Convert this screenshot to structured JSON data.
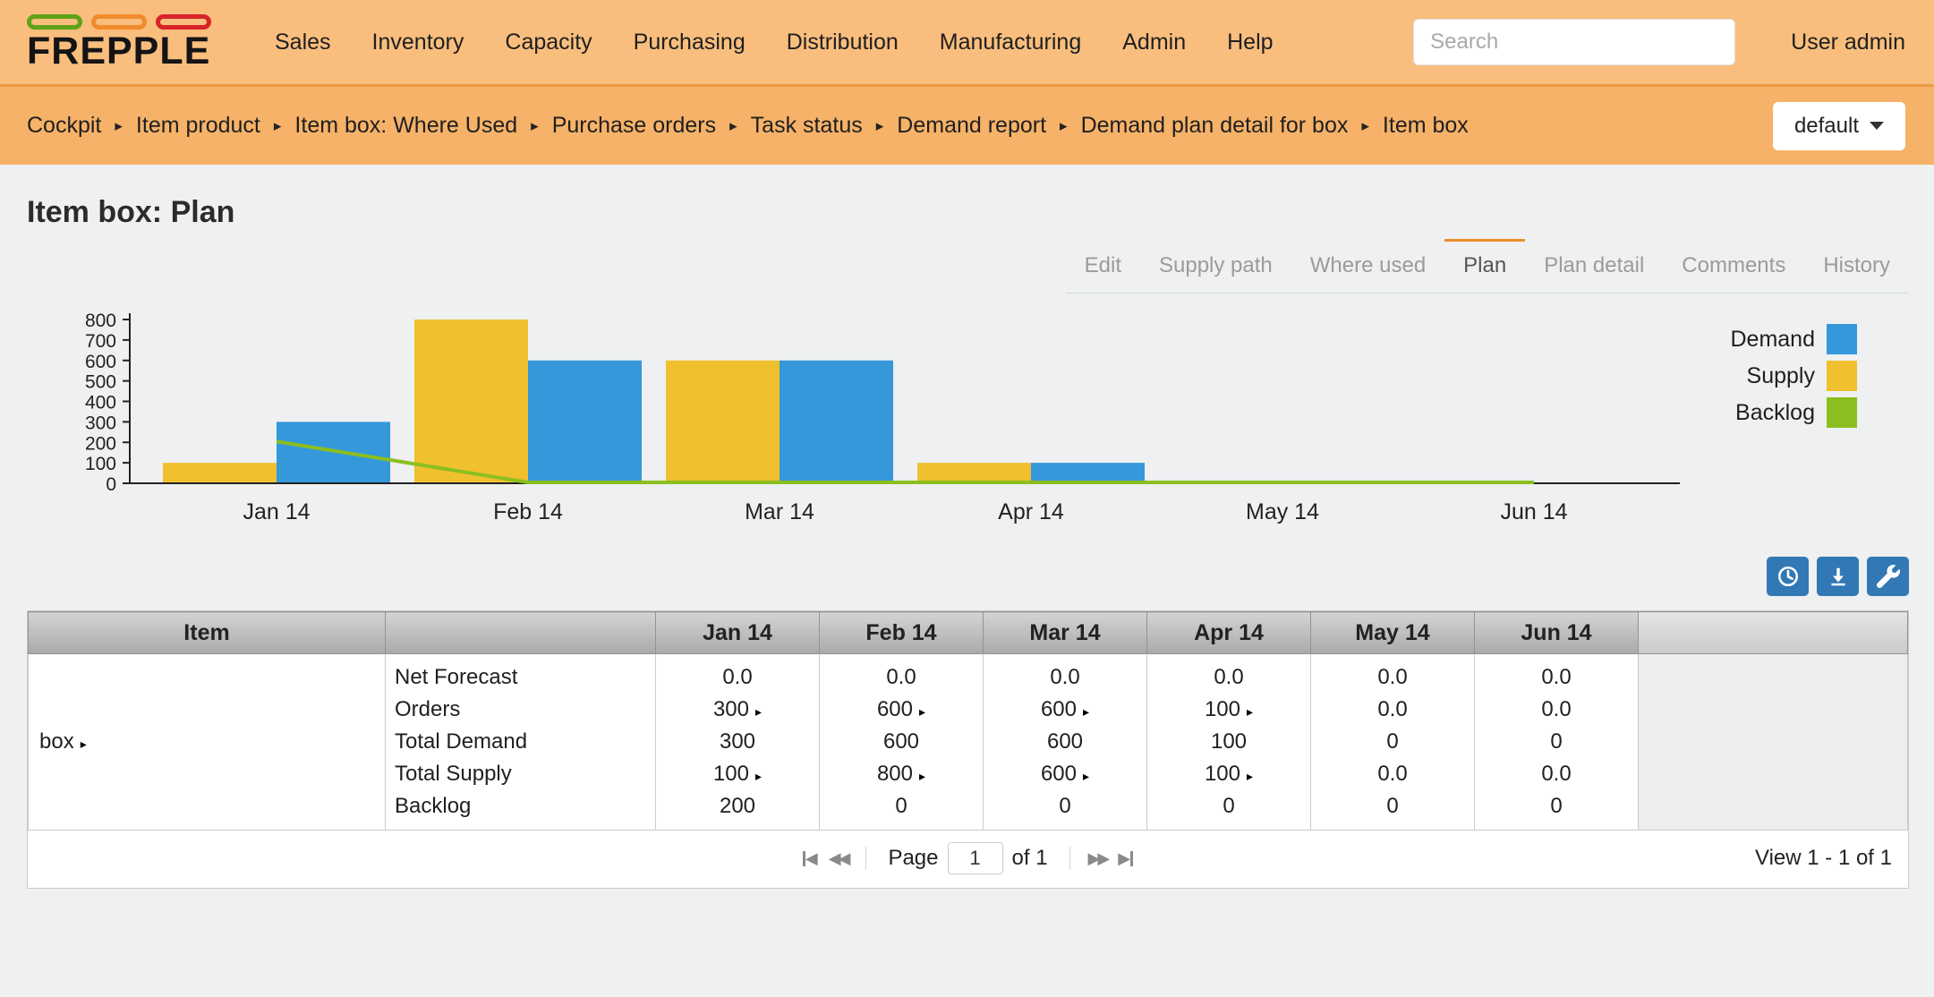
{
  "navbar": {
    "brand": "FREPPLE",
    "menu": [
      "Sales",
      "Inventory",
      "Capacity",
      "Purchasing",
      "Distribution",
      "Manufacturing",
      "Admin",
      "Help"
    ],
    "search_placeholder": "Search",
    "user_label": "User admin"
  },
  "breadcrumbs": [
    "Cockpit",
    "Item product",
    "Item box: Where Used",
    "Purchase orders",
    "Task status",
    "Demand report",
    "Demand plan detail for box",
    "Item box"
  ],
  "view_selector": {
    "label": "default"
  },
  "page_title": "Item box: Plan",
  "tabs": {
    "items": [
      "Edit",
      "Supply path",
      "Where used",
      "Plan",
      "Plan detail",
      "Comments",
      "History"
    ],
    "active": "Plan"
  },
  "chart_data": {
    "type": "bar",
    "categories": [
      "Jan 14",
      "Feb 14",
      "Mar 14",
      "Apr 14",
      "May 14",
      "Jun 14"
    ],
    "series": [
      {
        "name": "Demand",
        "type": "bar",
        "color": "#3498db",
        "values": [
          300,
          600,
          600,
          100,
          0,
          0
        ]
      },
      {
        "name": "Supply",
        "type": "bar",
        "color": "#f0c02e",
        "values": [
          100,
          800,
          600,
          100,
          0,
          0
        ]
      },
      {
        "name": "Backlog",
        "type": "line",
        "color": "#8bbf1f",
        "values": [
          200,
          0,
          0,
          0,
          0,
          0
        ]
      }
    ],
    "ylim": [
      0,
      800
    ],
    "ytick_step": 100,
    "grid": false,
    "legend_position": "right"
  },
  "toolbar": {
    "buttons": [
      {
        "icon": "clock-icon"
      },
      {
        "icon": "download-icon"
      },
      {
        "icon": "wrench-icon"
      }
    ]
  },
  "grid": {
    "headers": [
      "Item",
      "",
      "Jan 14",
      "Feb 14",
      "Mar 14",
      "Apr 14",
      "May 14",
      "Jun 14",
      ""
    ],
    "row": {
      "item": "box",
      "metrics": [
        {
          "label": "Net Forecast",
          "values": [
            "0.0",
            "0.0",
            "0.0",
            "0.0",
            "0.0",
            "0.0"
          ],
          "drilldown": [
            false,
            false,
            false,
            false,
            false,
            false
          ]
        },
        {
          "label": "Orders",
          "values": [
            "300",
            "600",
            "600",
            "100",
            "0.0",
            "0.0"
          ],
          "drilldown": [
            true,
            true,
            true,
            true,
            false,
            false
          ]
        },
        {
          "label": "Total Demand",
          "values": [
            "300",
            "600",
            "600",
            "100",
            "0",
            "0"
          ],
          "drilldown": [
            false,
            false,
            false,
            false,
            false,
            false
          ]
        },
        {
          "label": "Total Supply",
          "values": [
            "100",
            "800",
            "600",
            "100",
            "0.0",
            "0.0"
          ],
          "drilldown": [
            true,
            true,
            true,
            true,
            false,
            false
          ]
        },
        {
          "label": "Backlog",
          "values": [
            "200",
            "0",
            "0",
            "0",
            "0",
            "0"
          ],
          "drilldown": [
            false,
            false,
            false,
            false,
            false,
            false
          ]
        }
      ]
    }
  },
  "pager": {
    "page_label": "Page",
    "current_page": "1",
    "of_label": "of 1",
    "view_summary": "View 1 - 1 of 1"
  },
  "colors": {
    "accent": "#ef8b2d",
    "navbar": "#f9be7d",
    "breadcrumb": "#f6b268",
    "button_blue": "#3178b5"
  }
}
